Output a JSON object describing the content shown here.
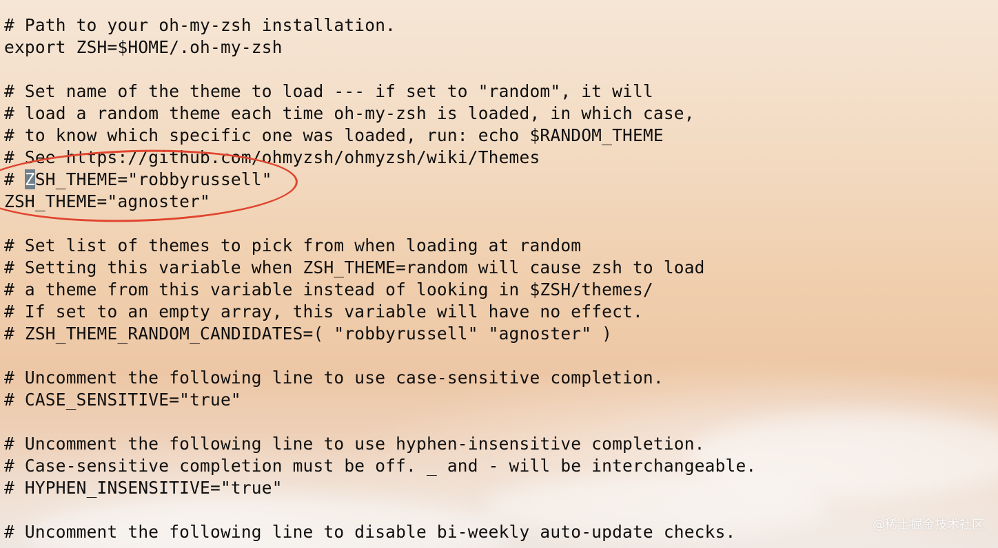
{
  "editor": {
    "lines": [
      "# Path to your oh-my-zsh installation.",
      "export ZSH=$HOME/.oh-my-zsh",
      "",
      "# Set name of the theme to load --- if set to \"random\", it will",
      "# load a random theme each time oh-my-zsh is loaded, in which case,",
      "# to know which specific one was loaded, run: echo $RANDOM_THEME",
      "# See https://github.com/ohmyzsh/ohmyzsh/wiki/Themes",
      "",
      "ZSH_THEME=\"agnoster\"",
      "",
      "# Set list of themes to pick from when loading at random",
      "# Setting this variable when ZSH_THEME=random will cause zsh to load",
      "# a theme from this variable instead of looking in $ZSH/themes/",
      "# If set to an empty array, this variable will have no effect.",
      "# ZSH_THEME_RANDOM_CANDIDATES=( \"robbyrussell\" \"agnoster\" )",
      "",
      "# Uncomment the following line to use case-sensitive completion.",
      "# CASE_SENSITIVE=\"true\"",
      "",
      "# Uncomment the following line to use hyphen-insensitive completion.",
      "# Case-sensitive completion must be off. _ and - will be interchangeable.",
      "# HYPHEN_INSENSITIVE=\"true\"",
      "",
      "# Uncomment the following line to disable bi-weekly auto-update checks."
    ],
    "cursor_line": {
      "before": "# ",
      "cursor_char": "Z",
      "after": "SH_THEME=\"robbyrussell\""
    }
  },
  "colors": {
    "annotation": "#e0452f",
    "cursor": "#6f7f8a"
  },
  "watermark": "@稀土掘金技术社区"
}
